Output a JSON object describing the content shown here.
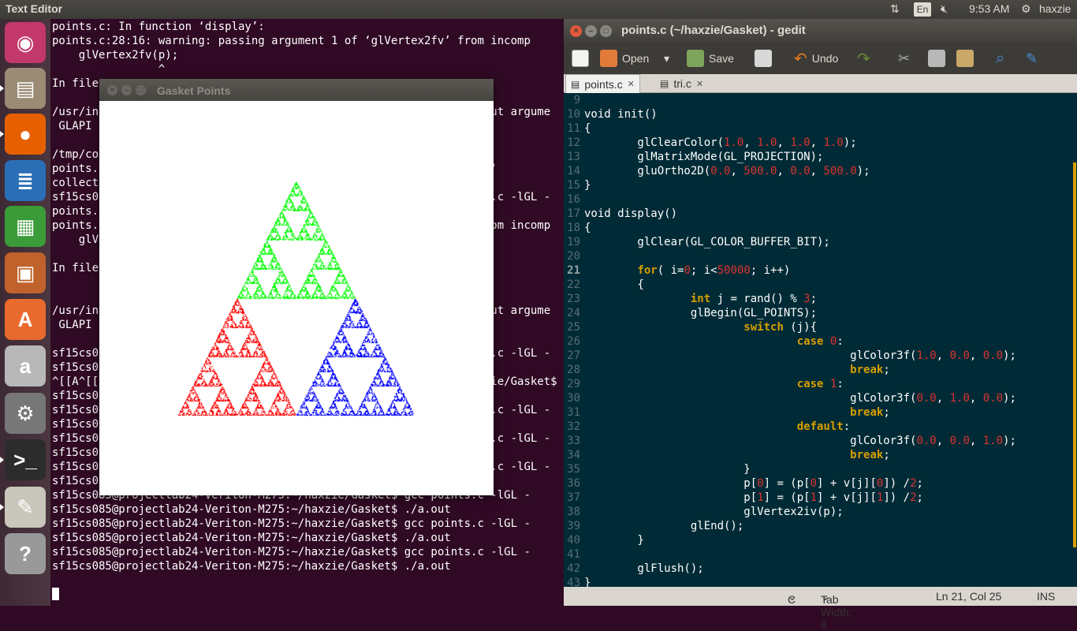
{
  "topbar": {
    "app_title": "Text Editor",
    "lang": "En",
    "time": "9:53 AM",
    "user": "haxzie"
  },
  "launcher": {
    "items": [
      {
        "name": "ubuntu-dash",
        "glyph": "◉",
        "color": "#c2386a"
      },
      {
        "name": "files",
        "glyph": "▤",
        "color": "#9b8a74"
      },
      {
        "name": "firefox",
        "glyph": "●",
        "color": "#e66000"
      },
      {
        "name": "libreoffice-writer",
        "glyph": "≣",
        "color": "#2a6fb6"
      },
      {
        "name": "libreoffice-calc",
        "glyph": "▦",
        "color": "#3a9b38"
      },
      {
        "name": "libreoffice-impress",
        "glyph": "▣",
        "color": "#c0622b"
      },
      {
        "name": "software-center",
        "glyph": "A",
        "color": "#e86a2c"
      },
      {
        "name": "amazon",
        "glyph": "a",
        "color": "#b8b8b8"
      },
      {
        "name": "system-settings",
        "glyph": "⚙",
        "color": "#777"
      },
      {
        "name": "terminal",
        "glyph": ">_",
        "color": "#2c2c2c"
      },
      {
        "name": "gedit",
        "glyph": "✎",
        "color": "#c9c6bb"
      },
      {
        "name": "help",
        "glyph": "?",
        "color": "#999"
      }
    ]
  },
  "terminal": {
    "lines": [
      "points.c: In function ‘display’:",
      "points.c:28:16: warning: passing argument 1 of ‘glVertex2fv’ from incomp",
      "    glVertex2fv(p);",
      "                ^",
      "In file",
      "",
      "/usr/in                                                          out argume",
      " GLAPI ",
      "",
      "/tmp/co",
      "points.                                                          e'",
      "collect",
      "sf15cs0                                                          s.c -lGL -",
      "points.",
      "points.                                                          rom incomp",
      "    glV",
      "",
      "In file",
      "",
      "",
      "/usr/in                                                          out argume",
      " GLAPI ",
      "",
      "sf15cs0                                                          s.c -lGL -",
      "sf15cs0",
      "^[[A^[[                                                          zie/Gasket$",
      "sf15cs0",
      "sf15cs0                                                          s.c -lGL -",
      "sf15cs0",
      "sf15cs0                                                          s.c -lGL -",
      "sf15cs0",
      "sf15cs0                                                          s.c -lGL -",
      "sf15cs085@projectlab24-Veriton-M275:~/haxzie/Gasket$ ./a.out",
      "sf15cs085@projectlab24-Veriton-M275:~/haxzie/Gasket$ gcc points.c -lGL -",
      "sf15cs085@projectlab24-Veriton-M275:~/haxzie/Gasket$ ./a.out",
      "sf15cs085@projectlab24-Veriton-M275:~/haxzie/Gasket$ gcc points.c -lGL -",
      "sf15cs085@projectlab24-Veriton-M275:~/haxzie/Gasket$ ./a.out",
      "sf15cs085@projectlab24-Veriton-M275:~/haxzie/Gasket$ gcc points.c -lGL -",
      "sf15cs085@projectlab24-Veriton-M275:~/haxzie/Gasket$ ./a.out"
    ]
  },
  "gasket_window": {
    "title": "Gasket Points",
    "colors": {
      "red": "#ff0000",
      "green": "#00ff00",
      "blue": "#0000ff"
    }
  },
  "gedit": {
    "title": "points.c (~/haxzie/Gasket) - gedit",
    "toolbar": {
      "open_label": "Open",
      "save_label": "Save",
      "undo_label": "Undo"
    },
    "tabs": [
      {
        "label": "points.c",
        "active": true
      },
      {
        "label": "tri.c",
        "active": false
      }
    ],
    "line_numbers": [
      "9",
      "10",
      "11",
      "12",
      "13",
      "14",
      "15",
      "16",
      "17",
      "18",
      "19",
      "20",
      "21",
      "22",
      "23",
      "24",
      "25",
      "26",
      "27",
      "28",
      "29",
      "30",
      "31",
      "32",
      "33",
      "34",
      "35",
      "36",
      "37",
      "38",
      "39",
      "40",
      "41",
      "42",
      "43"
    ],
    "current_line": "21",
    "code_lines": [
      "",
      "void init()",
      "{",
      "        glClearColor(1.0, 1.0, 1.0, 1.0);",
      "        glMatrixMode(GL_PROJECTION);",
      "        gluOrtho2D(0.0, 500.0, 0.0, 500.0);",
      "}",
      "",
      "void display()",
      "{",
      "        glClear(GL_COLOR_BUFFER_BIT);",
      "",
      "        for( i=0; i<50000; i++)",
      "        {",
      "                int j = rand() % 3;",
      "                glBegin(GL_POINTS);",
      "                        switch (j){",
      "                                case 0:",
      "                                        glColor3f(1.0, 0.0, 0.0);",
      "                                        break;",
      "                                case 1:",
      "                                        glColor3f(0.0, 1.0, 0.0);",
      "                                        break;",
      "                                default:",
      "                                        glColor3f(0.0, 0.0, 1.0);",
      "                                        break;",
      "                        }",
      "                        p[0] = (p[0] + v[j][0]) /2;",
      "                        p[1] = (p[1] + v[j][1]) /2;",
      "                        glVertex2iv(p);",
      "                glEnd();",
      "        }",
      "",
      "        glFlush();",
      "}"
    ],
    "status": {
      "language": "C",
      "tab_width": "Tab Width: 8",
      "position": "Ln 21, Col 25",
      "mode": "INS"
    },
    "syntax_colors": {
      "keyword": "#d79e00",
      "number": "#dc322f",
      "text": "#ffffff"
    }
  }
}
